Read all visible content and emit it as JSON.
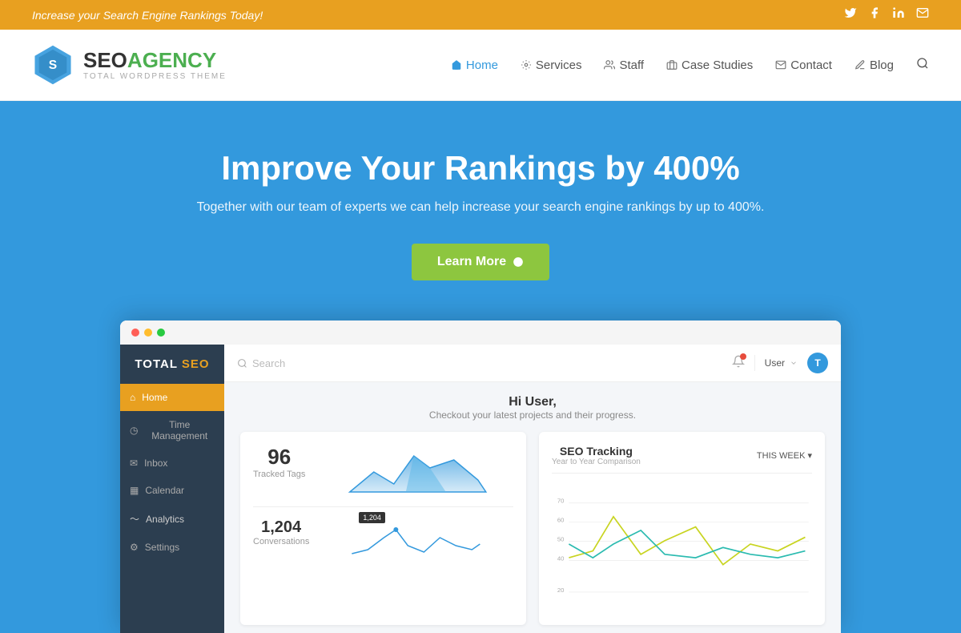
{
  "topbar": {
    "message": "Increase your Search Engine Rankings Today!",
    "icons": [
      "twitter",
      "facebook",
      "linkedin",
      "email"
    ]
  },
  "header": {
    "logo": {
      "seo": "SEO",
      "agency": "AGENCY",
      "sub": "TOTAL WORDPRESS THEME"
    },
    "nav": [
      {
        "label": "Home",
        "active": true,
        "icon": "home"
      },
      {
        "label": "Services",
        "active": false,
        "icon": "cog"
      },
      {
        "label": "Staff",
        "active": false,
        "icon": "users"
      },
      {
        "label": "Case Studies",
        "active": false,
        "icon": "briefcase"
      },
      {
        "label": "Contact",
        "active": false,
        "icon": "envelope"
      },
      {
        "label": "Blog",
        "active": false,
        "icon": "pencil"
      }
    ]
  },
  "hero": {
    "title": "Improve Your Rankings by 400%",
    "subtitle": "Together with our team of experts we can help increase your search engine rankings by up to 400%.",
    "cta_label": "Learn More"
  },
  "dashboard": {
    "sidebar": {
      "brand_total": "TOTAL ",
      "brand_seo": "SEO",
      "nav_items": [
        {
          "label": "Home",
          "active": true,
          "icon": "⌂"
        },
        {
          "label": "Time Management",
          "active": false,
          "icon": "◷"
        },
        {
          "label": "Inbox",
          "active": false,
          "icon": "✉"
        },
        {
          "label": "Calendar",
          "active": false,
          "icon": "▦"
        },
        {
          "label": "Analytics",
          "active": false,
          "icon": "〜"
        },
        {
          "label": "Settings",
          "active": false,
          "icon": "⚙"
        }
      ]
    },
    "topbar": {
      "search_placeholder": "Search",
      "user_label": "User",
      "user_initial": "T"
    },
    "content": {
      "greeting": "Hi User,",
      "greeting_sub": "Checkout your latest projects and their progress.",
      "card1": {
        "stat1": "96",
        "stat1_label": "Tracked Tags",
        "stat2": "1,204",
        "stat2_label": "Conversations"
      },
      "card2": {
        "title": "SEO Tracking",
        "subtitle": "Year to Year Comparison",
        "week_label": "THIS WEEK",
        "y_labels": [
          "70",
          "60",
          "50",
          "40",
          "20"
        ]
      }
    }
  }
}
